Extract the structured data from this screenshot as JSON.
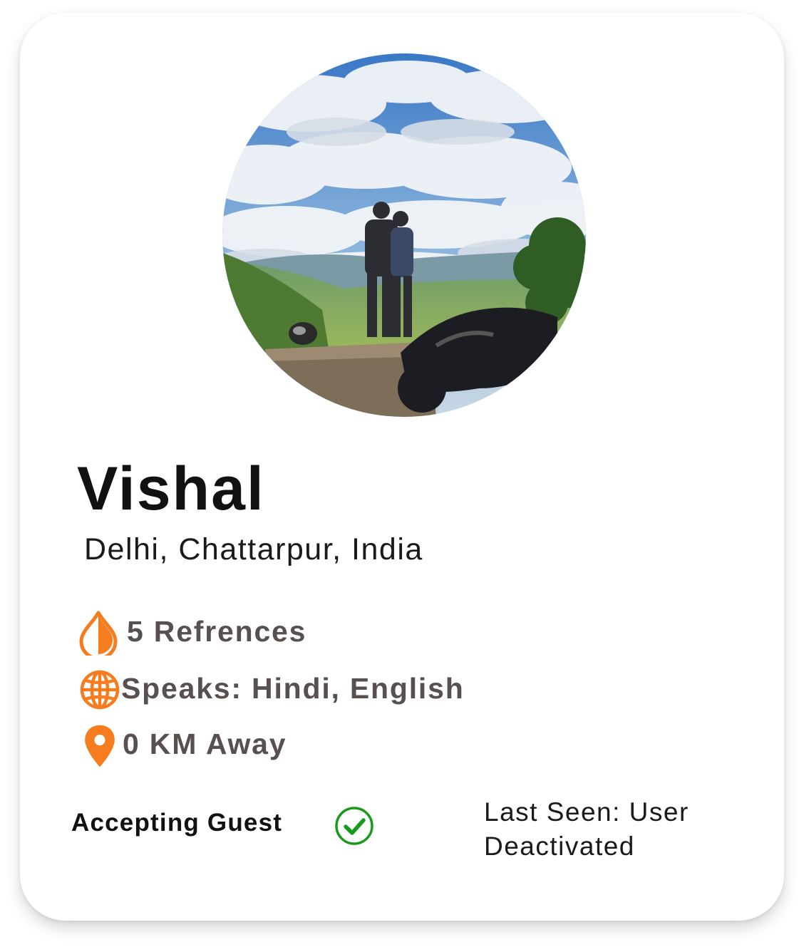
{
  "profile": {
    "name": "Vishal",
    "location": "Delhi, Chattarpur, India",
    "photo_icon": "profile-photo"
  },
  "info": {
    "references": {
      "icon": "drop-icon",
      "text": "5 Refrences"
    },
    "speaks": {
      "icon": "globe-icon",
      "text": "Speaks: Hindi, English"
    },
    "distance": {
      "icon": "map-pin-icon",
      "text": "0 KM Away"
    }
  },
  "status": {
    "accepting_label": "Accepting Guest",
    "accepting_icon": "check-circle-icon",
    "last_seen": "Last Seen: User Deactivated"
  },
  "colors": {
    "accent_orange": "#f57c1f",
    "check_green": "#1a9a1a",
    "info_text": "#57504f",
    "card_bg": "#ffffff"
  }
}
